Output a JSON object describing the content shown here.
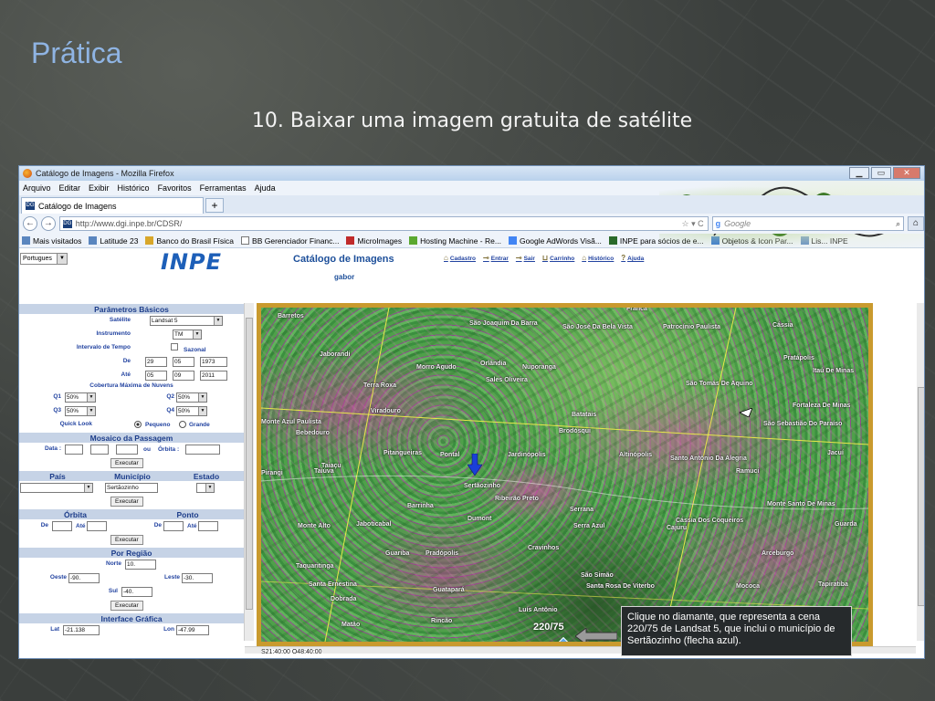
{
  "slide": {
    "title": "Prática",
    "subtitle": "10. Baixar uma imagem gratuita de satélite"
  },
  "browser": {
    "window_title": "Catálogo de Imagens - Mozilla Firefox",
    "window_buttons": [
      "▁",
      "▭",
      "✕"
    ],
    "menu": [
      "Arquivo",
      "Editar",
      "Exibir",
      "Histórico",
      "Favoritos",
      "Ferramentas",
      "Ajuda"
    ],
    "tab_label": "Catálogo de Imagens",
    "tab_icon_text": "DG",
    "new_tab": "+",
    "url": "http://www.dgi.inpe.br/CDSR/",
    "search_engine_label": "Google",
    "bookmarks": [
      "Mais visitados",
      "Latitude 23",
      "Banco do Brasil Física",
      "BB Gerenciador Financ...",
      "MicroImages",
      "Hosting Machine - Re...",
      "Google AdWords  Visã...",
      "INPE para sócios de e...",
      "Objetos & Icon Par...",
      "Lis... INPE"
    ]
  },
  "page": {
    "language": "Portugues",
    "logo": "INPE",
    "catalog_title": "Catálogo de Imagens",
    "user": "gabor",
    "top_links": [
      "Cadastro",
      "Entrar",
      "Sair",
      "Carrinho",
      "Histórico",
      "Ajuda"
    ]
  },
  "params": {
    "basic_title": "Parâmetros Básicos",
    "satellite_label": "Satélite",
    "satellite_value": "Landsat 5",
    "instrument_label": "Instrumento",
    "instrument_value": "TM",
    "time_interval_label": "Intervalo de Tempo",
    "seasonal_label": "Sazonal",
    "from_label": "De",
    "from_day": "29",
    "from_month": "05",
    "from_year": "1973",
    "to_label": "Até",
    "to_day": "05",
    "to_month": "09",
    "to_year": "2011",
    "cloud_label": "Cobertura Máxima de Nuvens",
    "q1_label": "Q1",
    "q1_value": "50%",
    "q2_label": "Q2",
    "q2_value": "50%",
    "q3_label": "Q3",
    "q3_value": "50%",
    "q4_label": "Q4",
    "q4_value": "50%",
    "quicklook_label": "Quick Look",
    "small_label": "Pequeno",
    "large_label": "Grande",
    "mosaic_title": "Mosaico da Passagem",
    "date_label": "Data :",
    "or_label": "ou",
    "orbit_label": "Órbita :",
    "execute": "Executar",
    "country_label": "País",
    "municipality_label": "Município",
    "state_label": "Estado",
    "municipality_value": "Sertãozinho",
    "orbit_title": "Órbita",
    "point_title": "Ponto",
    "de_label": "De",
    "ate_label": "Até",
    "region_title": "Por Região",
    "north_label": "Norte",
    "north_value": "10.",
    "west_label": "Oeste",
    "west_value": "-90.",
    "east_label": "Leste",
    "east_value": "-30.",
    "south_label": "Sul",
    "south_value": "-40.",
    "graphic_title": "Interface Gráfica",
    "lat_label": "Lat",
    "lat_value": "-21.138",
    "lon_label": "Lon",
    "lon_value": "-47.99"
  },
  "map": {
    "scene": "220/75",
    "status": "S21:40:00 O48:40:00",
    "places": [
      "Franca",
      "Barretos",
      "São Joaquim Da Barra",
      "São José Da Bela Vista",
      "Patrocínio Paulista",
      "Cássia",
      "Pratápolis",
      "Jaborandi",
      "Morro Agudo",
      "Orlândia",
      "Nuporanga",
      "Sales Oliveira",
      "São Tomás De Aquino",
      "Itaú De Minas",
      "Terra Roxa",
      "Viradouro",
      "Batatais",
      "Fortaleza De Minas",
      "Monte Azul Paulista",
      "Bebedouro",
      "Brodósqui",
      "São Sebastião Do Paraíso",
      "Pitangueiras",
      "Pontal",
      "Jardinópolis",
      "Altinópolis",
      "Santo Antônio Da Alegria",
      "Jacuí",
      "Taiaçu",
      "Pirangi",
      "Taiúva",
      "Sertãozinho",
      "Ribeirão Preto",
      "Ramuci",
      "Barrinha",
      "Serrana",
      "Monte Santo De Minas",
      "Dumont",
      "Cássia Dos Coqueiros",
      "Cajuru",
      "Monte Alto",
      "Jaboticabal",
      "Serra Azul",
      "Guarda",
      "Guariba",
      "Pradópolis",
      "Cravinhos",
      "Arceburgo",
      "São Simão",
      "Santa Rosa De Viterbo",
      "Taquaritinga",
      "Santa Ernestina",
      "Mococa",
      "Tapiratiba",
      "Dobrada",
      "Guatapará",
      "Luís Antônio",
      "Matão",
      "Rincão"
    ]
  },
  "callout": {
    "text": "Clique no diamante, que representa a cena 220/75 de Landsat 5, que inclui o município de Sertãozinho (flecha azul)."
  }
}
